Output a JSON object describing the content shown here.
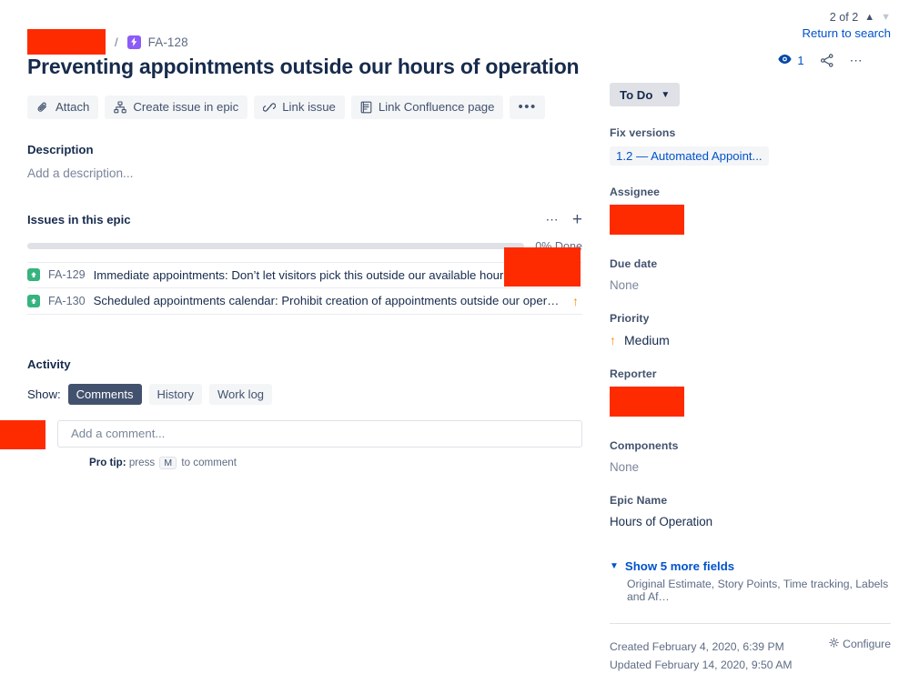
{
  "breadcrumb": {
    "project_redacted": true,
    "separator": "/",
    "issue_key": "FA-128",
    "epic_icon": "epic-bolt-icon"
  },
  "issue": {
    "title": "Preventing appointments outside our hours of operation"
  },
  "actions": {
    "attach": "Attach",
    "create_issue_in_epic": "Create issue in epic",
    "link_issue": "Link issue",
    "link_confluence_page": "Link Confluence page",
    "more": "•••"
  },
  "description": {
    "heading": "Description",
    "placeholder": "Add a description..."
  },
  "epic": {
    "heading": "Issues in this epic",
    "progress_label": "0% Done",
    "progress_percent": 0,
    "issues": [
      {
        "key": "FA-129",
        "summary": "Immediate appointments: Don’t let visitors pick this outside our available hours.",
        "priority_icon": "priority-medium-up-icon",
        "assignee_redacted": true
      },
      {
        "key": "FA-130",
        "summary": "Scheduled appointments calendar: Prohibit creation of appointments outside our operation…",
        "priority_icon": "priority-medium-up-icon",
        "assignee_redacted": true
      }
    ]
  },
  "activity": {
    "heading": "Activity",
    "show_label": "Show:",
    "filters": [
      {
        "label": "Comments",
        "active": true
      },
      {
        "label": "History",
        "active": false
      },
      {
        "label": "Work log",
        "active": false
      }
    ],
    "comment_placeholder": "Add a comment...",
    "comment_value": "",
    "protip_prefix": "Pro tip:",
    "protip_text_1": "press",
    "protip_key": "M",
    "protip_text_2": "to comment"
  },
  "header": {
    "nav_count": "2 of 2",
    "prev_icon": "chevron-up-icon",
    "next_icon": "chevron-down-icon",
    "return_to_search": "Return to search",
    "watch_icon": "eye-watch-icon",
    "watch_count": "1",
    "share_icon": "share-icon",
    "more_icon": "more-options-icon"
  },
  "status": {
    "label": "To Do",
    "chevron": "▼"
  },
  "fields": {
    "fix_versions": {
      "label": "Fix versions",
      "value": "1.2 — Automated Appoint..."
    },
    "assignee": {
      "label": "Assignee",
      "redacted": true
    },
    "due_date": {
      "label": "Due date",
      "value": "None"
    },
    "priority": {
      "label": "Priority",
      "value": "Medium",
      "icon": "priority-medium-up-icon"
    },
    "reporter": {
      "label": "Reporter",
      "redacted": true
    },
    "components": {
      "label": "Components",
      "value": "None"
    },
    "epic_name": {
      "label": "Epic Name",
      "value": "Hours of Operation"
    }
  },
  "more_fields": {
    "link": "Show 5 more fields",
    "summary": "Original Estimate, Story Points, Time tracking, Labels and Af…"
  },
  "footer": {
    "created": "Created February 4, 2020, 6:39 PM",
    "updated": "Updated February 14, 2020, 9:50 AM",
    "configure": "Configure",
    "configure_icon": "gear-icon"
  },
  "colors": {
    "link": "#0052cc",
    "text": "#172b4d",
    "subtle_text": "#5e6c84",
    "epic_purple": "#8b5cf6",
    "story_green": "#36b37e",
    "priority_orange": "#ff8b00",
    "redaction": "#fe2b00",
    "chip_bg": "#f4f5f7",
    "chip_active_bg": "#42526e"
  }
}
